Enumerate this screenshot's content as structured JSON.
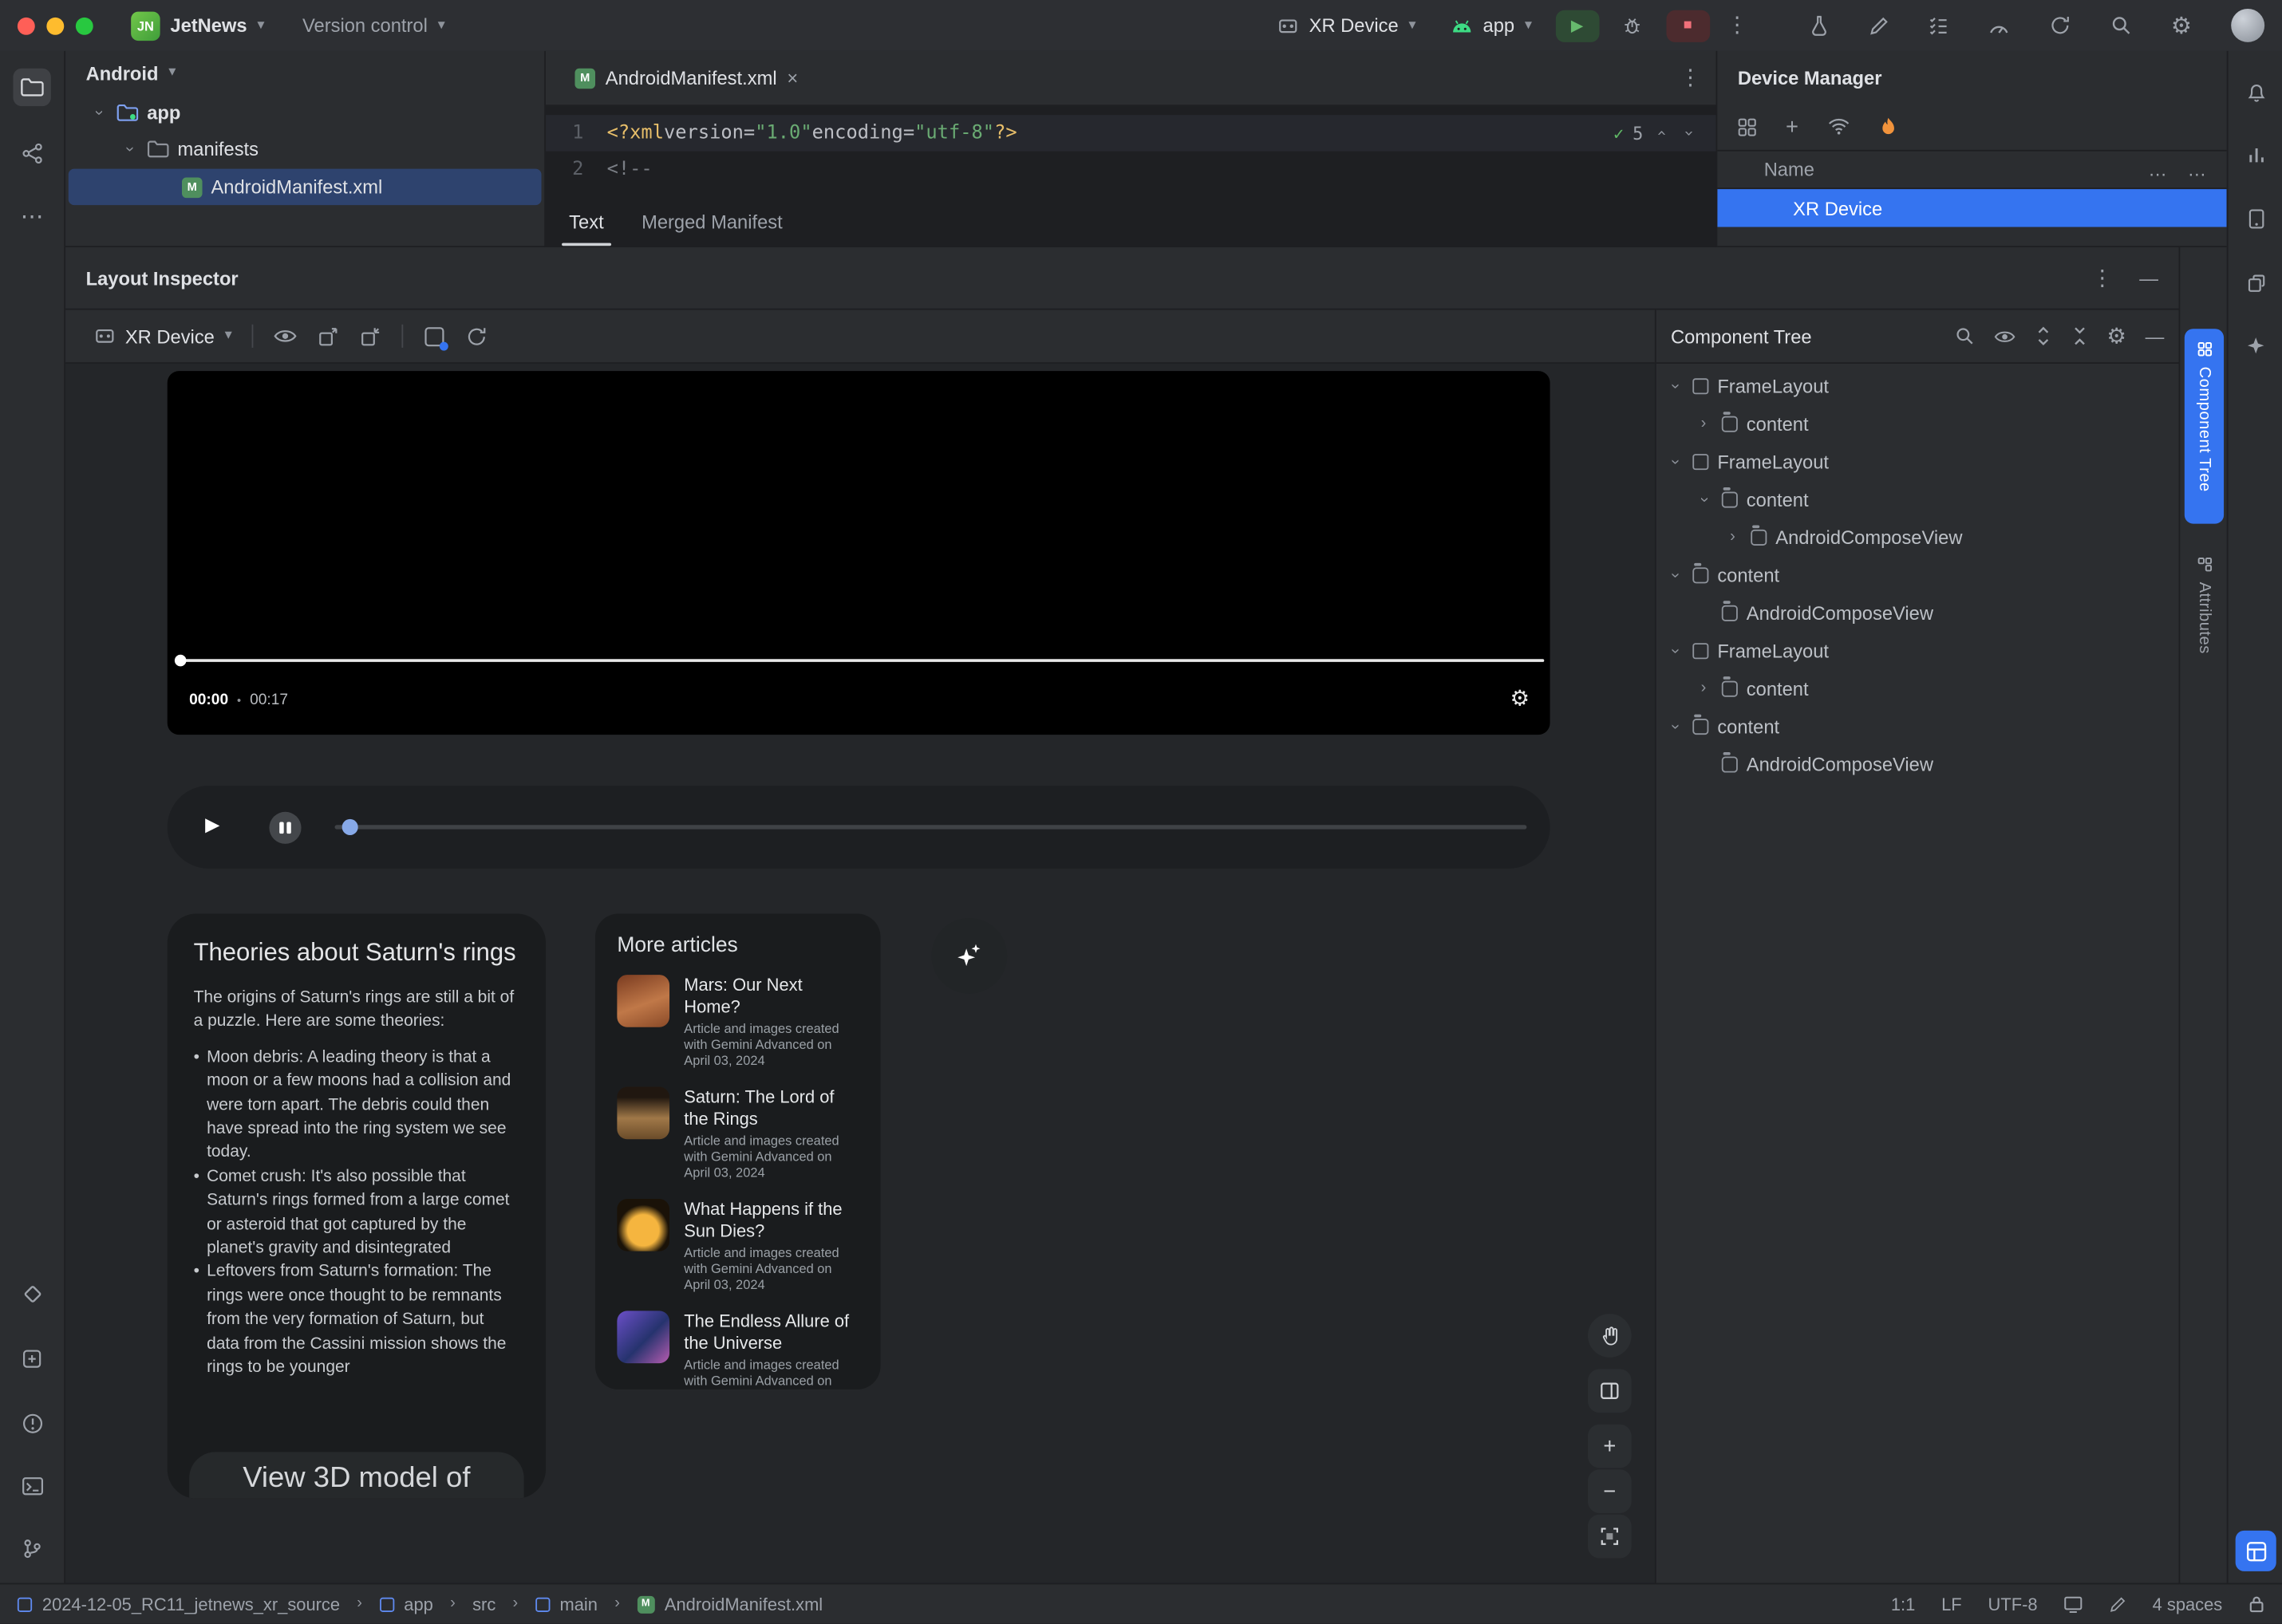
{
  "icons": {
    "chevron_down": "▾",
    "chevron_right": "›",
    "kebab": "⋮",
    "ellipsis_h": "⋯",
    "dots": "…",
    "gear": "⚙",
    "play": "▶",
    "stop": "■",
    "check": "✓",
    "bullet": "•",
    "plus": "+",
    "minus": "−",
    "close": "×",
    "minimize": "—"
  },
  "titlebar": {
    "logo": "JN",
    "project_name": "JetNews",
    "vcs_label": "Version control",
    "device_selector": "XR Device",
    "run_config": "app"
  },
  "project_panel": {
    "header": "Android",
    "app_node": "app",
    "manifests_node": "manifests",
    "manifest_file": "AndroidManifest.xml"
  },
  "editor": {
    "tab_title": "AndroidManifest.xml",
    "line1": "1",
    "line2": "2",
    "code": {
      "decl_open": "<?xml",
      "attr_version": " version=",
      "val_version": "\"1.0\"",
      "attr_encoding": " encoding=",
      "val_encoding": "\"utf-8\"",
      "decl_close": "?>",
      "comment": "<!--"
    },
    "inspections_count": "5",
    "tab_text": "Text",
    "tab_merged": "Merged Manifest"
  },
  "device_manager": {
    "title": "Device Manager",
    "name_column": "Name",
    "device_row": "XR Device"
  },
  "layout_inspector": {
    "title": "Layout Inspector",
    "device": "XR Device",
    "player": {
      "current": "00:00",
      "separator": "•",
      "total": "00:17"
    },
    "saturn_card": {
      "title": "Theories about Saturn's rings",
      "intro": "The origins of Saturn's rings are still a bit of a puzzle. Here are some theories:",
      "bullets": [
        "Moon debris: A leading theory is that a moon or a few moons had a collision and were torn apart. The debris could then have spread into the ring system we see today.",
        "Comet crush: It's also possible that Saturn's rings formed from a large comet or asteroid that got captured by the planet's gravity and disintegrated",
        "Leftovers from Saturn's formation: The rings were once thought to be remnants from the very formation of Saturn, but data from the Cassini mission shows the rings to be younger"
      ],
      "clipped_button": "View 3D model of"
    },
    "articles_card": {
      "title": "More articles",
      "items": [
        {
          "title": "Mars: Our Next Home?",
          "caption": "Article and images created with Gemini Advanced on April 03, 2024"
        },
        {
          "title": "Saturn: The Lord of the Rings",
          "caption": "Article and images created with Gemini Advanced on April 03, 2024"
        },
        {
          "title": "What Happens if the Sun Dies?",
          "caption": "Article and images created with Gemini Advanced on April 03, 2024"
        },
        {
          "title": "The Endless Allure of the Universe",
          "caption": "Article and images created with Gemini Advanced on"
        }
      ]
    },
    "component_tree": {
      "title": "Component Tree",
      "nodes": [
        {
          "label": "FrameLayout"
        },
        {
          "label": "content"
        },
        {
          "label": "FrameLayout"
        },
        {
          "label": "content"
        },
        {
          "label": "AndroidComposeView"
        },
        {
          "label": "content"
        },
        {
          "label": "AndroidComposeView"
        },
        {
          "label": "FrameLayout"
        },
        {
          "label": "content"
        },
        {
          "label": "content"
        },
        {
          "label": "AndroidComposeView"
        }
      ]
    }
  },
  "right_tabs": {
    "component_tree": "Component Tree",
    "attributes": "Attributes"
  },
  "status_bar": {
    "crumbs": [
      "2024-12-05_RC11_jetnews_xr_source",
      "app",
      "src",
      "main",
      "AndroidManifest.xml"
    ],
    "cursor": "1:1",
    "line_sep": "LF",
    "encoding": "UTF-8",
    "indent": "4 spaces"
  },
  "colors": {
    "accent": "#3574F0",
    "run_green": "#5FB865",
    "stop_red": "#F1707A",
    "flame": "#F1933C"
  }
}
